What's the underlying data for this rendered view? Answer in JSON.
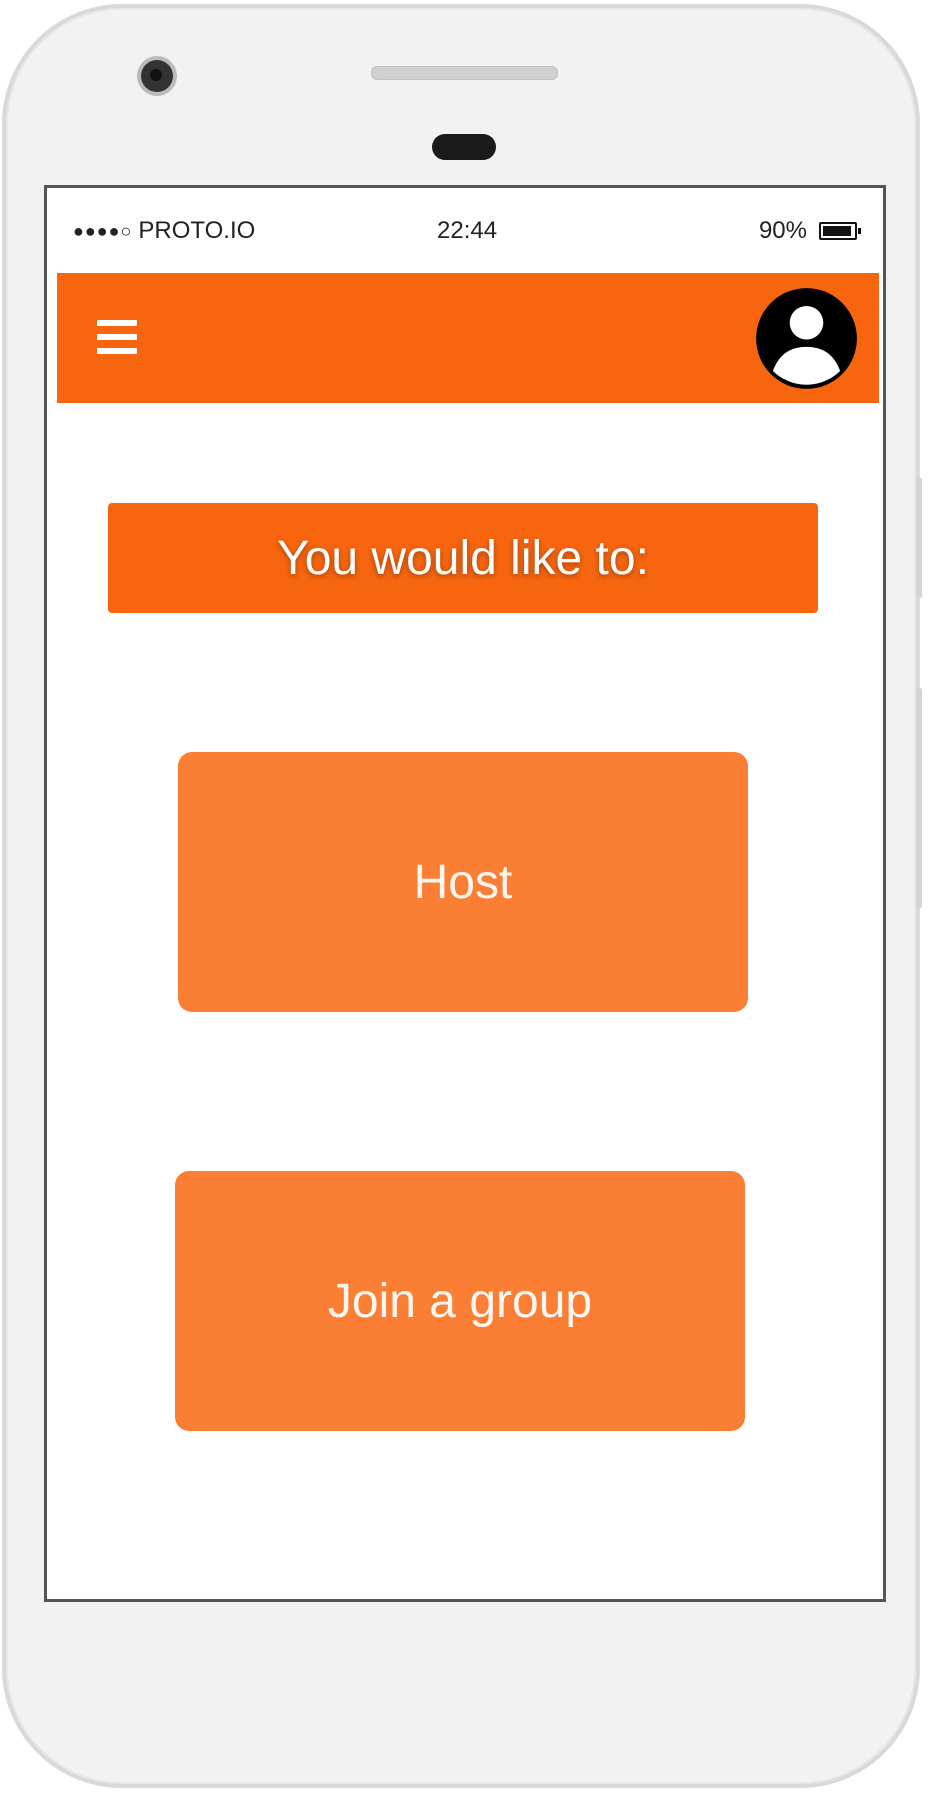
{
  "status_bar": {
    "carrier": "PROTO.IO",
    "signal_dots": "●●●●○",
    "time": "22:44",
    "battery_percent": "90%"
  },
  "app_bar": {
    "background_color": "#f8650f",
    "menu_icon": "hamburger-menu-icon",
    "avatar_icon": "user-avatar-icon"
  },
  "main": {
    "prompt": "You would like to:",
    "options": [
      {
        "label": "Host"
      },
      {
        "label": "Join a group"
      }
    ]
  },
  "colors": {
    "accent": "#f8650f",
    "button": "#fa7f35"
  }
}
